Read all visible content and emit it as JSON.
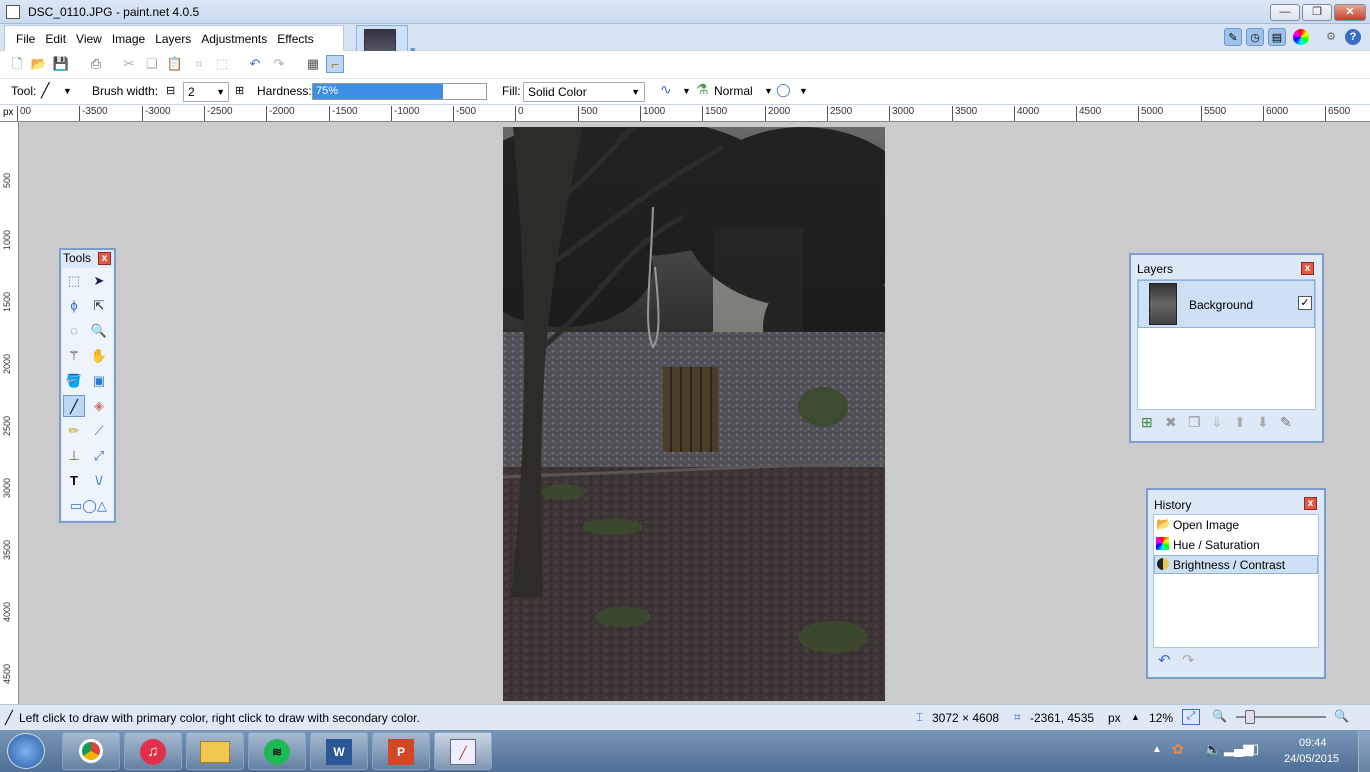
{
  "window": {
    "title": "DSC_0110.JPG - paint.net 4.0.5"
  },
  "menu": [
    "File",
    "Edit",
    "View",
    "Image",
    "Layers",
    "Adjustments",
    "Effects"
  ],
  "toolbar2": {
    "tool_label": "Tool:",
    "brush_width_label": "Brush width:",
    "brush_width_value": "2",
    "hardness_label": "Hardness:",
    "hardness_value": "75%",
    "hardness_fraction": 0.75,
    "fill_label": "Fill:",
    "fill_value": "Solid Color",
    "blend_mode": "Normal"
  },
  "ruler": {
    "unit": "px",
    "h_labels": [
      "00",
      "-3500",
      "-3000",
      "-2500",
      "-2000",
      "-1500",
      "-1000",
      "-500",
      "0",
      "500",
      "1000",
      "1500",
      "2000",
      "2500",
      "3000",
      "3500",
      "4000",
      "4500",
      "5000",
      "5500",
      "6000",
      "6500"
    ],
    "v_labels": [
      "500",
      "1000",
      "1500",
      "2000",
      "2500",
      "3000",
      "3500",
      "4000",
      "4500"
    ]
  },
  "tools_window": {
    "title": "Tools"
  },
  "layers_window": {
    "title": "Layers",
    "layers": [
      {
        "name": "Background",
        "visible": true
      }
    ]
  },
  "history_window": {
    "title": "History",
    "items": [
      "Open Image",
      "Hue / Saturation",
      "Brightness / Contrast"
    ],
    "selected": 2
  },
  "status": {
    "hint": "Left click to draw with primary color, right click to draw with secondary color.",
    "image_size": "3072 × 4608",
    "cursor_pos": "-2361, 4535",
    "unit": "px",
    "zoom": "12%"
  },
  "taskbar": {
    "time": "09:44",
    "date": "24/05/2015"
  },
  "colors": {
    "accent": "#3d8fe6",
    "window_border": "#7b9ccf",
    "canvas_bg": "#cbcbcb"
  }
}
